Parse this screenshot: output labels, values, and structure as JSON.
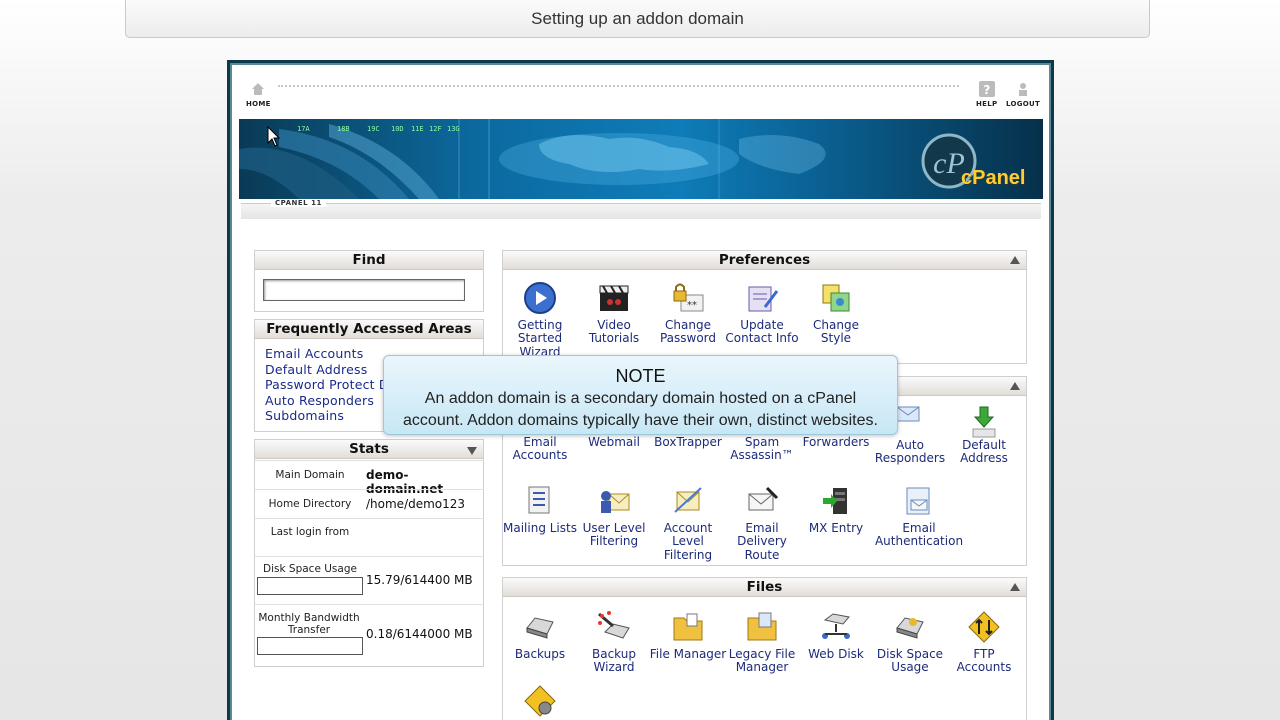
{
  "title_bar": {
    "text": "Setting up an addon domain"
  },
  "topnav": {
    "home": "HOME",
    "help": "HELP",
    "logout": "LOGOUT"
  },
  "banner": {
    "logo_text": "cPanel",
    "version": "CPANEL 11",
    "ticker": [
      "17A",
      "18B",
      "19C",
      "10D",
      "11E",
      "12F",
      "13G"
    ]
  },
  "find": {
    "title": "Find",
    "value": ""
  },
  "faa": {
    "title": "Frequently Accessed Areas",
    "links": [
      "Email Accounts",
      "Default Address",
      "Password Protect D",
      "Auto Responders",
      "Subdomains"
    ]
  },
  "stats": {
    "title": "Stats",
    "main_domain_label": "Main Domain",
    "main_domain_value": "demo-domain.net",
    "home_dir_label": "Home Directory",
    "home_dir_value": "/home/demo123",
    "last_login_label": "Last login from",
    "last_login_value": "",
    "disk_label": "Disk Space Usage",
    "disk_value": "15.79/614400 MB",
    "bw_label": "Monthly Bandwidth Transfer",
    "bw_value": "0.18/6144000 MB"
  },
  "preferences": {
    "title": "Preferences",
    "items": [
      "Getting Started Wizard",
      "Video Tutorials",
      "Change Password",
      "Update Contact Info",
      "Change Style"
    ]
  },
  "mail": {
    "items": [
      "Email Accounts",
      "Webmail",
      "BoxTrapper",
      "Spam Assassin™",
      "Forwarders",
      "Auto Responders",
      "Default Address",
      "Mailing Lists",
      "User Level Filtering",
      "Account Level Filtering",
      "Email Delivery Route",
      "MX Entry",
      "Email Authentication"
    ]
  },
  "files": {
    "title": "Files",
    "items": [
      "Backups",
      "Backup Wizard",
      "File Manager",
      "Legacy File Manager",
      "Web Disk",
      "Disk Space Usage",
      "FTP Accounts"
    ]
  },
  "note": {
    "title": "NOTE",
    "line1": "An addon domain is a secondary domain hosted on a cPanel",
    "line2": "account. Addon domains typically have their own, distinct websites."
  },
  "colors": {
    "link": "#1a2a88",
    "icon_label": "#1d2b7a",
    "frame": "#0d3a4a",
    "note_bg": "#c7e7f5",
    "logo": "#ffce2e"
  }
}
